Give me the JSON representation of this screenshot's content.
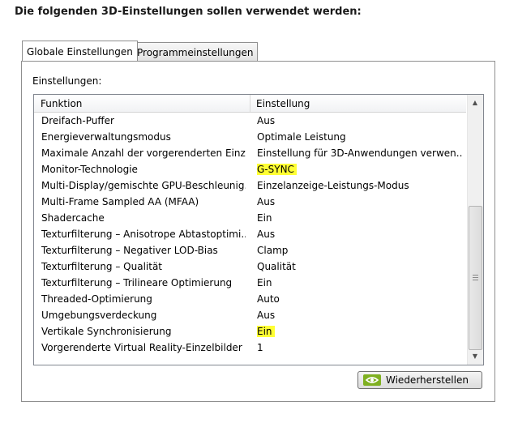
{
  "heading": "Die folgenden 3D-Einstellungen sollen verwendet werden:",
  "tabs": [
    {
      "label": "Globale Einstellungen",
      "active": true
    },
    {
      "label": "Programmeinstellungen",
      "active": false
    }
  ],
  "settings_label": "Einstellungen:",
  "columns": {
    "function": "Funktion",
    "setting": "Einstellung"
  },
  "rows": [
    {
      "name": "Dreifach-Puffer",
      "value": "Aus",
      "highlight": false
    },
    {
      "name": "Energieverwaltungsmodus",
      "value": "Optimale Leistung",
      "highlight": false
    },
    {
      "name": "Maximale Anzahl der vorgerenderten Einz...",
      "value": "Einstellung für 3D-Anwendungen verwen...",
      "highlight": false
    },
    {
      "name": "Monitor-Technologie",
      "value": "G-SYNC",
      "highlight": true
    },
    {
      "name": "Multi-Display/gemischte GPU-Beschleunig...",
      "value": "Einzelanzeige-Leistungs-Modus",
      "highlight": false
    },
    {
      "name": "Multi-Frame Sampled AA (MFAA)",
      "value": "Aus",
      "highlight": false
    },
    {
      "name": "Shadercache",
      "value": "Ein",
      "highlight": false
    },
    {
      "name": "Texturfilterung – Anisotrope Abtastoptimi...",
      "value": "Aus",
      "highlight": false
    },
    {
      "name": "Texturfilterung – Negativer LOD-Bias",
      "value": "Clamp",
      "highlight": false
    },
    {
      "name": "Texturfilterung – Qualität",
      "value": "Qualität",
      "highlight": false
    },
    {
      "name": "Texturfilterung – Trilineare Optimierung",
      "value": "Ein",
      "highlight": false
    },
    {
      "name": "Threaded-Optimierung",
      "value": "Auto",
      "highlight": false
    },
    {
      "name": "Umgebungsverdeckung",
      "value": "Aus",
      "highlight": false
    },
    {
      "name": "Vertikale Synchronisierung",
      "value": "Ein",
      "highlight": true
    },
    {
      "name": "Vorgerenderte Virtual Reality-Einzelbilder",
      "value": "1",
      "highlight": false
    }
  ],
  "highlight_color": "#ffff33",
  "restore_button": {
    "label": "Wiederherstellen",
    "icon": "nvidia-logo-icon"
  },
  "scrollbar": {
    "up_icon": "scroll-up-arrow-icon",
    "down_icon": "scroll-down-arrow-icon"
  }
}
